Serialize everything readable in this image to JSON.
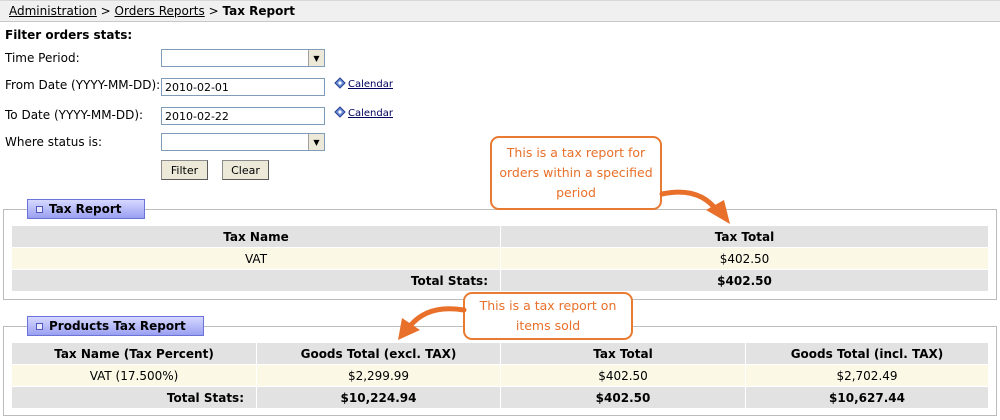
{
  "breadcrumb": {
    "items": [
      "Administration",
      "Orders Reports"
    ],
    "separator": ">",
    "current": "Tax Report"
  },
  "filter": {
    "title": "Filter orders stats:",
    "time_period_label": "Time Period:",
    "time_period_value": "",
    "from_date_label": "From Date (YYYY-MM-DD):",
    "from_date_value": "2010-02-01",
    "to_date_label": "To Date (YYYY-MM-DD):",
    "to_date_value": "2010-02-22",
    "status_label": "Where status is:",
    "status_value": "",
    "calendar_link": "Calendar",
    "filter_button": "Filter",
    "clear_button": "Clear"
  },
  "tax_report": {
    "title": "Tax Report",
    "headers": [
      "Tax Name",
      "Tax Total"
    ],
    "rows": [
      [
        "VAT",
        "$402.50"
      ]
    ],
    "total_label": "Total Stats:",
    "total_value": "$402.50"
  },
  "products_tax_report": {
    "title": "Products Tax Report",
    "headers": [
      "Tax Name (Tax Percent)",
      "Goods Total (excl. TAX)",
      "Tax Total",
      "Goods Total (incl. TAX)"
    ],
    "rows": [
      [
        "VAT (17.500%)",
        "$2,299.99",
        "$402.50",
        "$2,702.49"
      ]
    ],
    "total_label": "Total Stats:",
    "totals": [
      "$10,224.94",
      "$402.50",
      "$10,627.44"
    ]
  },
  "callouts": {
    "tax_report_note": [
      "This is a tax report for",
      "orders within a specified",
      "period"
    ],
    "products_note": [
      "This is a tax report on",
      "items sold"
    ]
  },
  "colors": {
    "accent_orange": "#e8702a",
    "panel_tab_blue": "#9aa0f2",
    "header_gray": "#e2e2e2",
    "row_cream": "#fbf8e6"
  }
}
